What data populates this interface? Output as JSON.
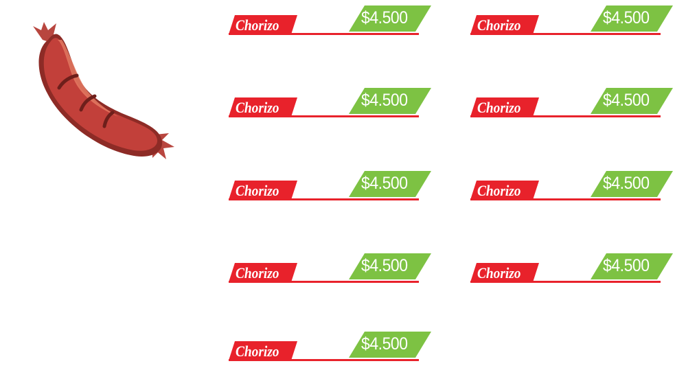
{
  "illustration": {
    "icon": "sausage-icon",
    "colors": {
      "body": "#c2403a",
      "outline": "#8d2b26",
      "highlight": "#e57a63",
      "cut": "#6e1f1b"
    }
  },
  "colors": {
    "name_tag": "#e8222b",
    "price_tag": "#7dc243",
    "text": "#ffffff",
    "background": "#ffffff"
  },
  "menu": {
    "items": [
      {
        "name": "Chorizo",
        "price": "$4.500"
      },
      {
        "name": "Chorizo",
        "price": "$4.500"
      },
      {
        "name": "Chorizo",
        "price": "$4.500"
      },
      {
        "name": "Chorizo",
        "price": "$4.500"
      },
      {
        "name": "Chorizo",
        "price": "$4.500"
      },
      {
        "name": "Chorizo",
        "price": "$4.500"
      },
      {
        "name": "Chorizo",
        "price": "$4.500"
      },
      {
        "name": "Chorizo",
        "price": "$4.500"
      },
      {
        "name": "Chorizo",
        "price": "$4.500"
      }
    ]
  }
}
